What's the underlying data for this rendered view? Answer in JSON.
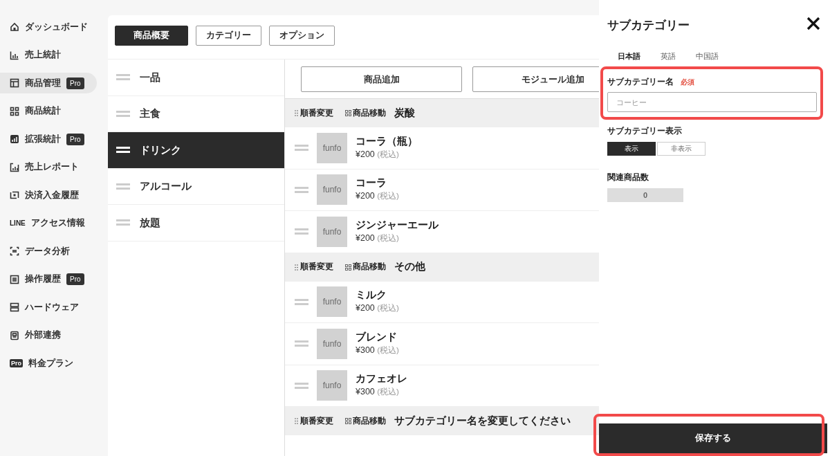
{
  "sidebar": {
    "items": [
      {
        "label": "ダッシュボード",
        "selected": false
      },
      {
        "label": "売上統計",
        "selected": false
      },
      {
        "label": "商品管理",
        "selected": true,
        "badge": "Pro"
      },
      {
        "label": "商品統計",
        "selected": false
      },
      {
        "label": "拡張統計",
        "selected": false,
        "badge": "Pro"
      },
      {
        "label": "売上レポート",
        "selected": false
      },
      {
        "label": "決済入金履歴",
        "selected": false
      },
      {
        "label": "アクセス情報",
        "logo_text": "LINE",
        "selected": false
      },
      {
        "label": "データ分析",
        "selected": false
      },
      {
        "label": "操作履歴",
        "selected": false,
        "badge": "Pro"
      },
      {
        "label": "ハードウェア",
        "selected": false
      },
      {
        "label": "外部連携",
        "selected": false
      },
      {
        "label": "料金プラン",
        "logo_text": "Pro",
        "selected": false
      }
    ]
  },
  "tabs": [
    {
      "label": "商品概要",
      "selected": true
    },
    {
      "label": "カテゴリー",
      "selected": false
    },
    {
      "label": "オプション",
      "selected": false
    }
  ],
  "categories": [
    {
      "label": "一品",
      "selected": false
    },
    {
      "label": "主食",
      "selected": false
    },
    {
      "label": "ドリンク",
      "selected": true
    },
    {
      "label": "アルコール",
      "selected": false
    },
    {
      "label": "放題",
      "selected": false
    }
  ],
  "actions": [
    "商品追加",
    "モジュール追加"
  ],
  "groups": [
    {
      "order_label": "順番変更",
      "move_label": "商品移動",
      "title": "炭酸",
      "items": [
        {
          "thumb": "funfo",
          "name": "コーラ（瓶）",
          "price": "¥200",
          "tax": "(税込)"
        },
        {
          "thumb": "funfo",
          "name": "コーラ",
          "price": "¥200",
          "tax": "(税込)"
        },
        {
          "thumb": "funfo",
          "name": "ジンジャーエール",
          "price": "¥200",
          "tax": "(税込)"
        }
      ]
    },
    {
      "order_label": "順番変更",
      "move_label": "商品移動",
      "title": "その他",
      "items": [
        {
          "thumb": "funfo",
          "name": "ミルク",
          "price": "¥200",
          "tax": "(税込)"
        },
        {
          "thumb": "funfo",
          "name": "ブレンド",
          "price": "¥300",
          "tax": "(税込)"
        },
        {
          "thumb": "funfo",
          "name": "カフェオレ",
          "price": "¥300",
          "tax": "(税込)"
        }
      ]
    },
    {
      "order_label": "順番変更",
      "move_label": "商品移動",
      "title": "サブカテゴリー名を変更してください"
    }
  ],
  "panel": {
    "title": "サブカテゴリー",
    "languages": [
      {
        "label": "日本語",
        "selected": true
      },
      {
        "label": "英語",
        "selected": false
      },
      {
        "label": "中国語",
        "selected": false
      }
    ],
    "name_label": "サブカテゴリー名",
    "required": "必須",
    "name_placeholder": "コーヒー",
    "visibility_label": "サブカテゴリー表示",
    "visibility": [
      {
        "label": "表示",
        "selected": true
      },
      {
        "label": "非表示",
        "selected": false
      }
    ],
    "count_label": "関連商品数",
    "count": "0",
    "save": "保存する"
  }
}
